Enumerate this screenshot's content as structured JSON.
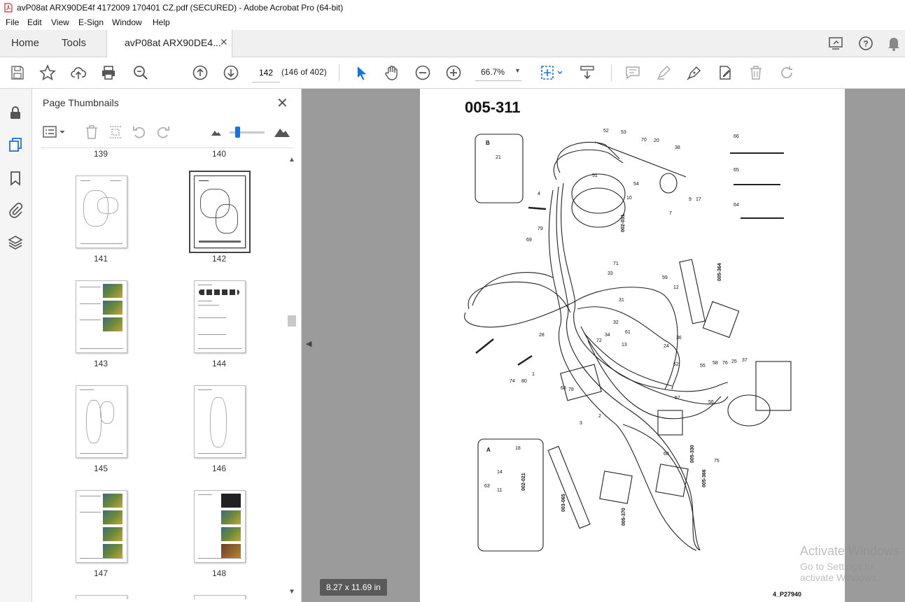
{
  "window": {
    "title": "avP08at ARX90DE4f 4172009 170401 CZ.pdf (SECURED) - Adobe Acrobat Pro (64-bit)"
  },
  "menu": [
    "File",
    "Edit",
    "View",
    "E-Sign",
    "Window",
    "Help"
  ],
  "tabs": {
    "home": "Home",
    "tools": "Tools",
    "document": "avP08at ARX90DE4..."
  },
  "toolbar": {
    "page_number": "142",
    "page_count": "(146 of 402)",
    "zoom": "66.7%"
  },
  "panel": {
    "title": "Page Thumbnails",
    "partial_top_labels": [
      "139",
      "140"
    ],
    "thumbnails": [
      "141",
      "142",
      "143",
      "144",
      "145",
      "146",
      "147",
      "148"
    ],
    "selected": "142"
  },
  "document": {
    "heading": "005-311",
    "footer": "4_P27940",
    "page_size": "8.27 x 11.69 in",
    "callouts": [
      "B",
      "A",
      "002-031",
      "003-065",
      "005-364",
      "002-021",
      "005-330",
      "005-366",
      "005-370",
      "52",
      "53",
      "70",
      "20",
      "38",
      "51",
      "54",
      "10",
      "9",
      "17",
      "7",
      "66",
      "65",
      "64",
      "4",
      "79",
      "69",
      "71",
      "33",
      "31",
      "59",
      "12",
      "61",
      "13",
      "62",
      "28",
      "74",
      "80",
      "1",
      "68",
      "78",
      "3",
      "2",
      "55",
      "58",
      "76",
      "25",
      "37",
      "56",
      "57",
      "60",
      "75",
      "63",
      "14",
      "11",
      "18",
      "72",
      "34",
      "32",
      "36",
      "24",
      "21"
    ]
  },
  "watermark": {
    "line1": "Activate Windows",
    "line2": "Go to Settings to activate Windows."
  },
  "colors": {
    "accent": "#1473e6",
    "viewport_bg": "#9b9b9b",
    "pdf_red": "#d7282f"
  }
}
